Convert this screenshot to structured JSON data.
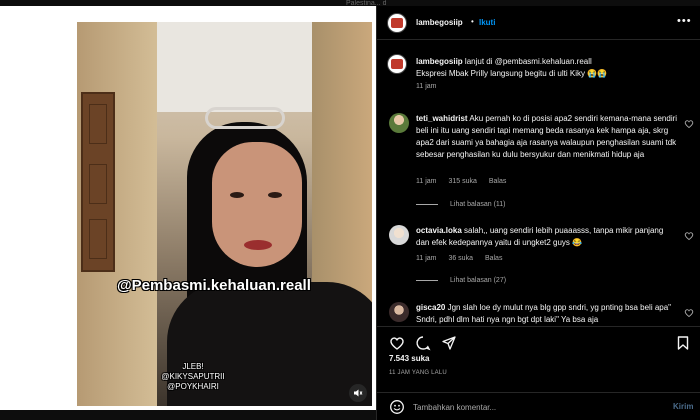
{
  "backdrop": {
    "text": "Palestina... dahlan... fajar dengan"
  },
  "post": {
    "username": "lambegosiip",
    "follow_label": "Ikuti",
    "video_overlay_handle": "@Pembasmi.kehaluan.reall",
    "video_overlay_caption": [
      "JLEB!",
      "@KIKYSAPUTRII",
      "@POYKHAIRI"
    ],
    "caption_line1": "lanjut di @pembasmi.kehaluan.reall",
    "caption_line2": "Ekspresi Mbak Prilly langsung begitu di ulti Kiky 😭😭",
    "caption_time": "11 jam",
    "likes": "7.543 suka",
    "posted_ago": "11 JAM YANG LALU"
  },
  "comments": [
    {
      "user": "teti_wahidrist",
      "text": "Aku pernah ko di posisi apa2 sendiri kemana-mana sendiri beli ini itu uang sendiri tapi memang beda rasanya kek hampa aja, skrg apa2 dari suami ya bahagia aja rasanya walaupun penghasilan suami tdk sebesar penghasilan ku dulu bersyukur dan menikmati hidup aja",
      "time": "11 jam",
      "likes": "315 suka",
      "reply": "Balas",
      "view_replies": "Lihat balasan (11)"
    },
    {
      "user": "octavia.loka",
      "text": "salah,, uang sendiri lebih puaaasss, tanpa mikir panjang dan efek kedepannya yaitu di ungket2 guys 😂",
      "time": "11 jam",
      "likes": "36 suka",
      "reply": "Balas",
      "view_replies": "Lihat balasan (27)"
    },
    {
      "user": "gisca20",
      "text": "Jgn slah loe dy mulut nya blg gpp sndri, yg pnting bsa beli apa\" Sndri, pdhl dlm hati nya ngn bgt dpt laki\" Ya bsa aja"
    }
  ],
  "composer": {
    "placeholder": "Tambahkan komentar...",
    "send_label": "Kirim"
  },
  "colors": {
    "accent": "#0095f6",
    "muted": "#a8a8a8",
    "divider": "#262626"
  }
}
